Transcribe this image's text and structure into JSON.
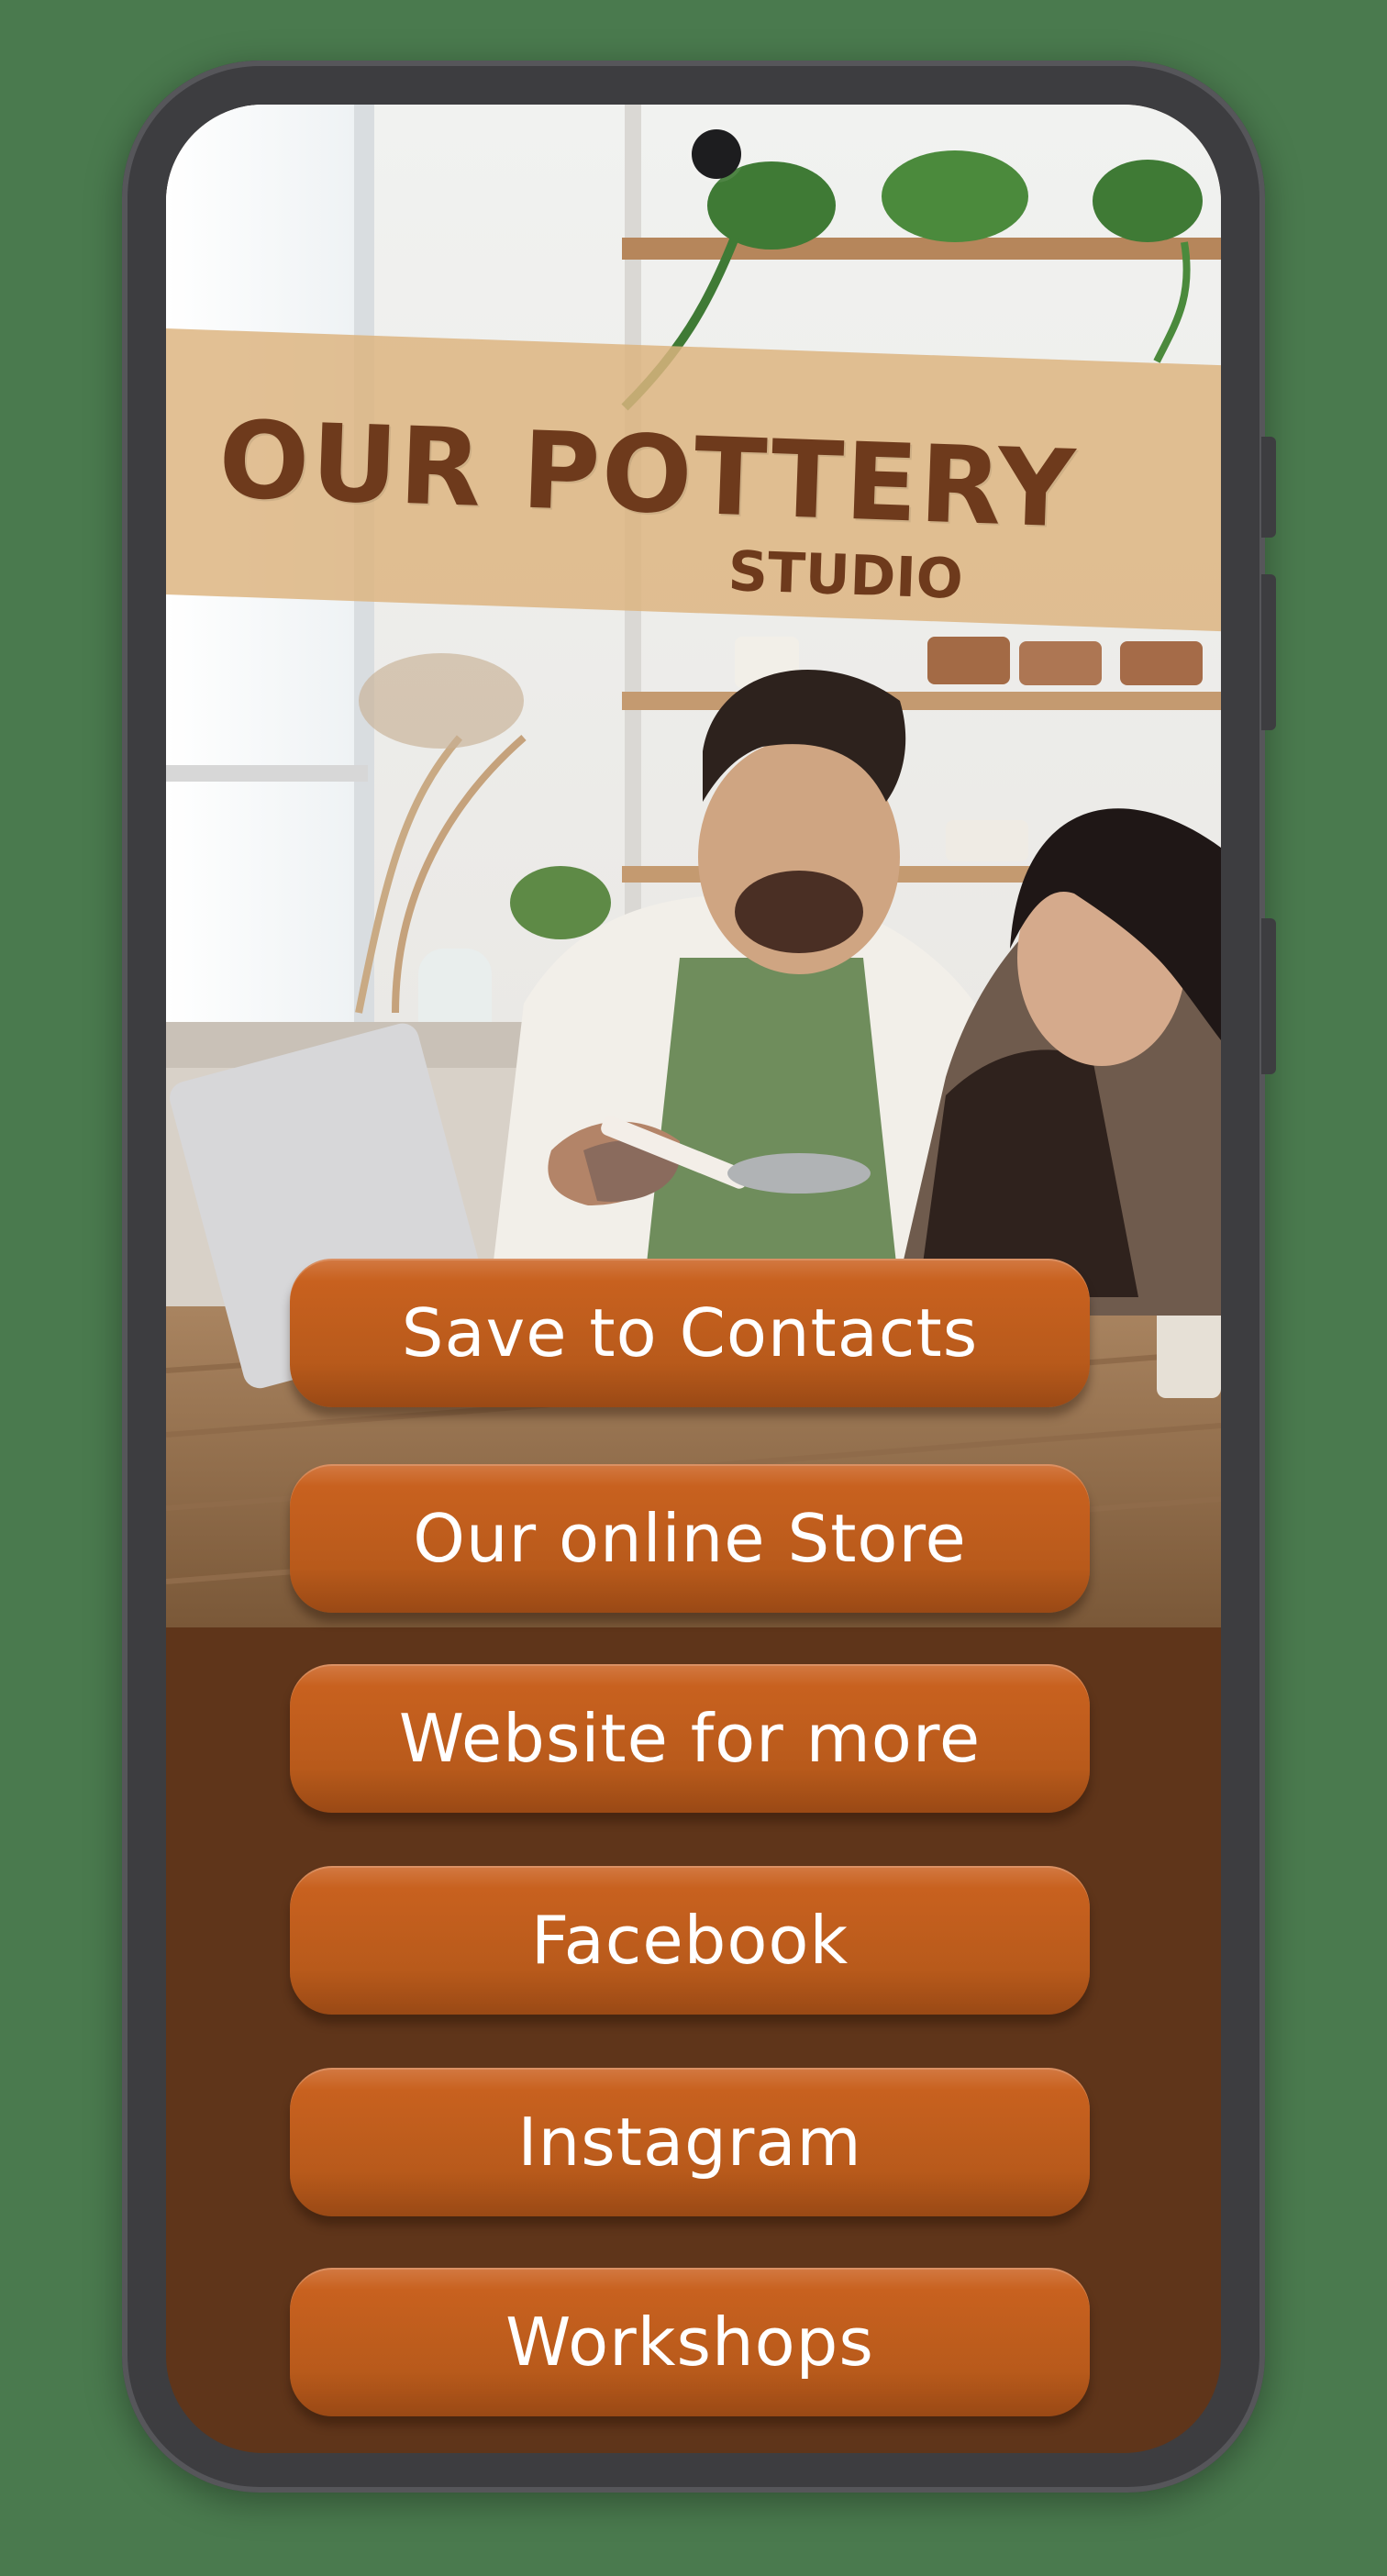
{
  "app": {
    "banner_title": "OUR POTTERY",
    "banner_subtitle": "STUDIO"
  },
  "buttons": [
    {
      "label": "Save to Contacts"
    },
    {
      "label": "Our online Store"
    },
    {
      "label": "Website for more"
    },
    {
      "label": "Facebook"
    },
    {
      "label": "Instagram"
    },
    {
      "label": "Workshops"
    }
  ],
  "colors": {
    "page_background": "#4a7a4e",
    "phone_frame": "#3d3d40",
    "screen_background": "#5f351a",
    "banner_fill": "#dcb480",
    "banner_text": "#6e3a1c",
    "button_fill": "#bf5b1d",
    "button_text": "#ffffff"
  },
  "icons": {
    "camera": "front-camera-icon"
  }
}
